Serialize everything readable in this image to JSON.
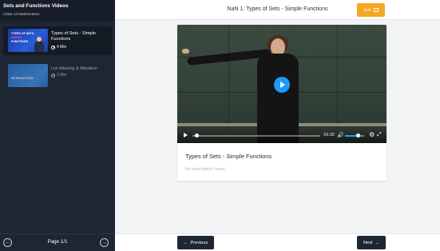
{
  "sidebar": {
    "title": "Sets and Functions Videos",
    "subtitle": "Class 12 Mathematics",
    "items": [
      {
        "title": "Types of Sets - Simple Functions",
        "duration": "4 Min",
        "active": true,
        "thumb_text": [
          "TYPES OF SETS -",
          "SIMPLE",
          "FUNCTIONS"
        ]
      },
      {
        "title": "List Aliasing & Mutation",
        "duration": "2 Min",
        "active": false,
        "thumb_text": [
          "INTRODUCTION"
        ]
      }
    ],
    "pagination": {
      "label": "Page 1/1",
      "prev_icon": "arrow-left-circle-icon",
      "next_icon": "arrow-right-circle-icon"
    }
  },
  "header": {
    "title": "NaN 1: Types of Sets - Simple Functions",
    "exit_label": "Exit",
    "exit_color": "#f5a623"
  },
  "video": {
    "time_remaining": "-01:32",
    "progress": 0.02,
    "volume": 0.7,
    "accent_color": "#1a9bfc"
  },
  "content": {
    "title": "Types of Sets - Simple Functions",
    "description": "No description found"
  },
  "footer": {
    "previous_label": "Previous",
    "next_label": "Next"
  }
}
